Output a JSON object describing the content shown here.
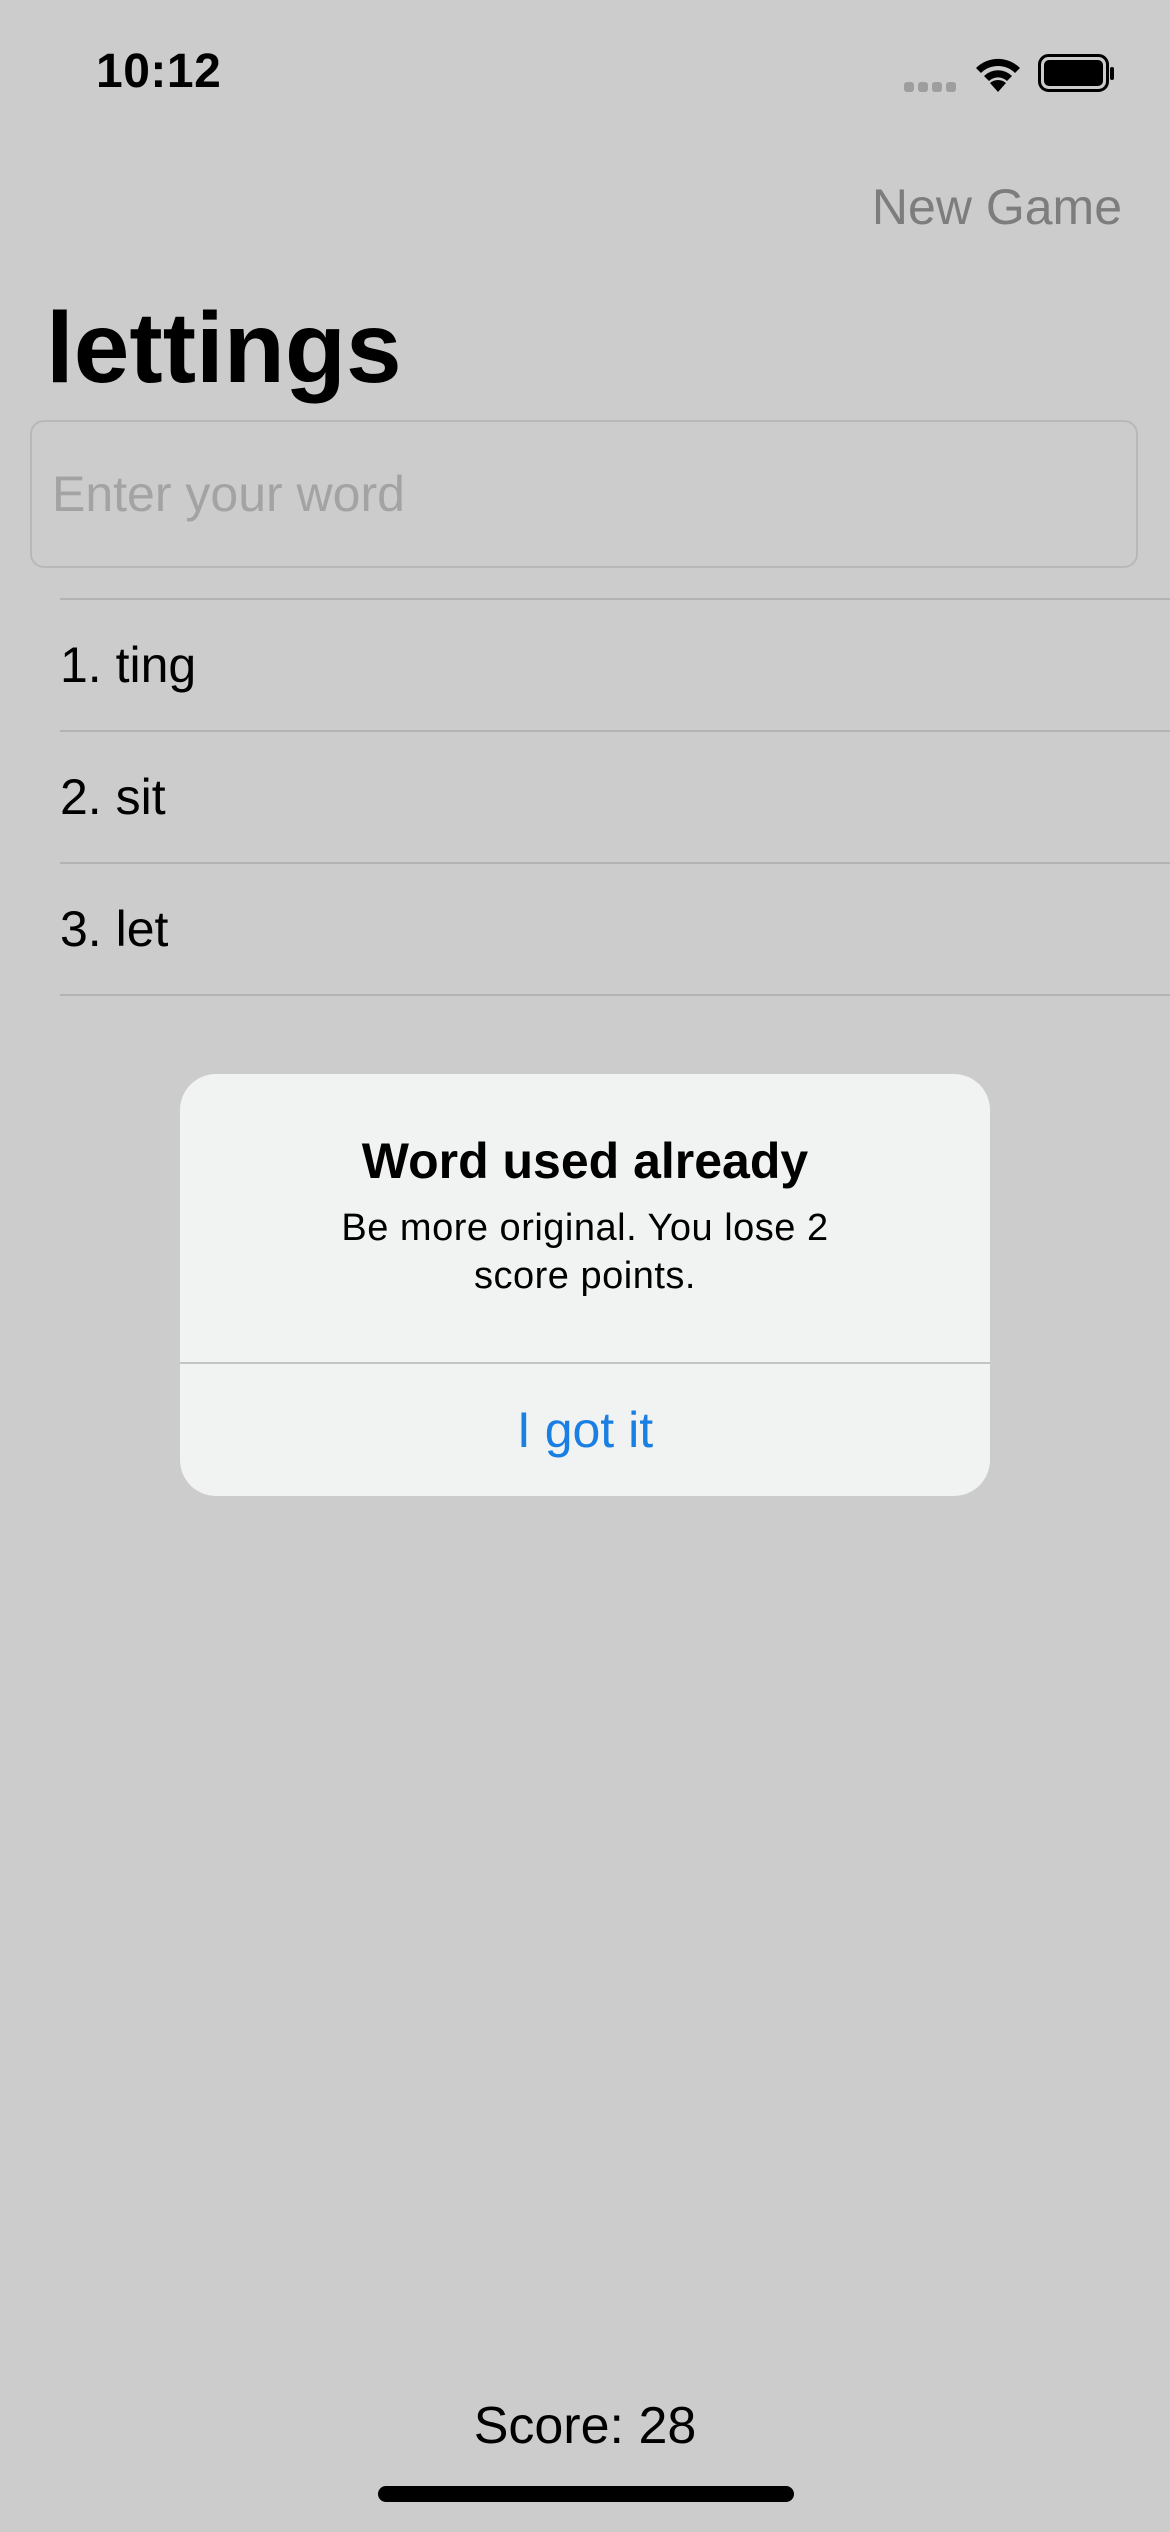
{
  "status_bar": {
    "time": "10:12"
  },
  "nav": {
    "new_game_label": "New Game"
  },
  "root_word": "lettings",
  "input": {
    "placeholder": "Enter your word",
    "value": ""
  },
  "used_words": [
    "1. ting",
    "2. sit",
    "3. let"
  ],
  "alert": {
    "title": "Word used already",
    "message": "Be more original. You lose 2 score points.",
    "button_label": "I got it"
  },
  "score": {
    "label": "Score: 28"
  },
  "colors": {
    "background": "#cccccc",
    "alert_background": "#f1f2f2",
    "accent": "#1a7fe3",
    "nav_button": "#7d7d7d"
  },
  "icons": [
    "signal-icon",
    "wifi-icon",
    "battery-icon"
  ]
}
